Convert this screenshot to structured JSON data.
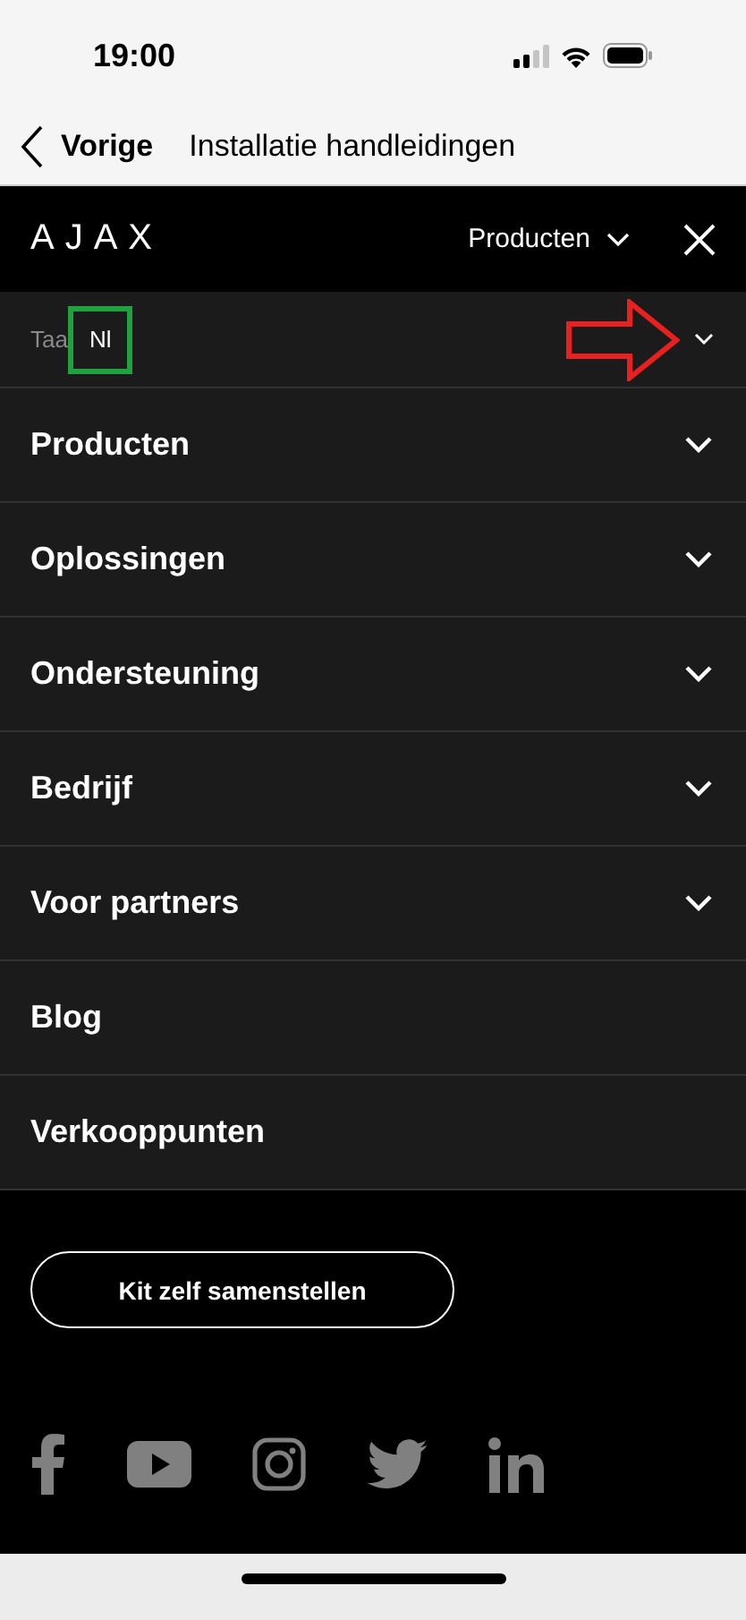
{
  "status_bar": {
    "time": "19:00"
  },
  "nav_bar": {
    "back_label": "Vorige",
    "title": "Installatie handleidingen"
  },
  "header": {
    "logo": "AJAX",
    "menu_label": "Producten"
  },
  "language": {
    "label": "Taa",
    "value": "Nl",
    "highlighted": true,
    "arrow_annotation": true
  },
  "menu": [
    {
      "label": "Producten",
      "expandable": true
    },
    {
      "label": "Oplossingen",
      "expandable": true
    },
    {
      "label": "Ondersteuning",
      "expandable": true
    },
    {
      "label": "Bedrijf",
      "expandable": true
    },
    {
      "label": "Voor partners",
      "expandable": true
    },
    {
      "label": "Blog",
      "expandable": false
    },
    {
      "label": "Verkooppunten",
      "expandable": false
    }
  ],
  "cta_button": "Kit zelf samenstellen",
  "social": [
    {
      "kind": "facebook"
    },
    {
      "kind": "youtube"
    },
    {
      "kind": "instagram"
    },
    {
      "kind": "twitter"
    },
    {
      "kind": "linkedin"
    }
  ]
}
